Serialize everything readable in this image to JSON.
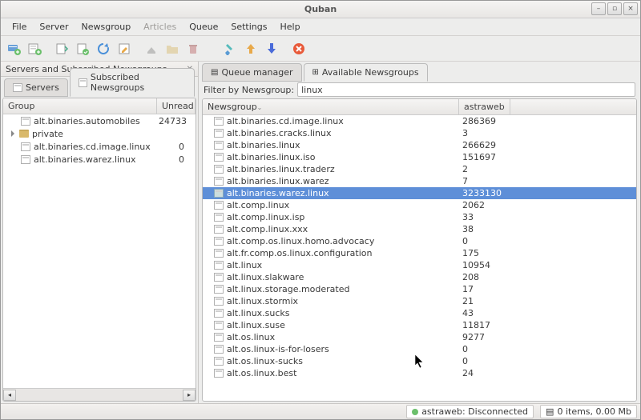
{
  "window": {
    "title": "Quban"
  },
  "menu": [
    "File",
    "Server",
    "Newsgroup",
    "Articles",
    "Queue",
    "Settings",
    "Help"
  ],
  "menu_disabled": [
    3
  ],
  "left": {
    "section_title": "Servers and Subscribed Newsgroups",
    "tabs": [
      {
        "label": "Servers",
        "icon": "server-icon"
      },
      {
        "label": "Subscribed Newsgroups",
        "icon": "news-icon"
      }
    ],
    "active_tab": 1,
    "columns": {
      "group": "Group",
      "unread": "Unread"
    },
    "rows": [
      {
        "name": "alt.binaries.automobiles",
        "unread": "24733",
        "indent": 1,
        "icon": "news"
      },
      {
        "name": "private",
        "unread": "",
        "indent": 0,
        "icon": "folder",
        "collapsible": true
      },
      {
        "name": "alt.binaries.cd.image.linux",
        "unread": "0",
        "indent": 1,
        "icon": "news"
      },
      {
        "name": "alt.binaries.warez.linux",
        "unread": "0",
        "indent": 1,
        "icon": "news"
      }
    ]
  },
  "right": {
    "tabs": [
      {
        "label": "Queue manager",
        "icon": "queue-icon"
      },
      {
        "label": "Available Newsgroups",
        "icon": "groups-icon"
      }
    ],
    "active_tab": 1,
    "filter_label": "Filter by Newsgroup:",
    "filter_value": "linux",
    "columns": {
      "newsgroup": "Newsgroup",
      "count": "astraweb"
    },
    "selected": 6,
    "rows": [
      {
        "name": "alt.binaries.cd.image.linux",
        "count": "286369"
      },
      {
        "name": "alt.binaries.cracks.linux",
        "count": "3"
      },
      {
        "name": "alt.binaries.linux",
        "count": "266629"
      },
      {
        "name": "alt.binaries.linux.iso",
        "count": "151697"
      },
      {
        "name": "alt.binaries.linux.traderz",
        "count": "2"
      },
      {
        "name": "alt.binaries.linux.warez",
        "count": "7"
      },
      {
        "name": "alt.binaries.warez.linux",
        "count": "3233130"
      },
      {
        "name": "alt.comp.linux",
        "count": "2062"
      },
      {
        "name": "alt.comp.linux.isp",
        "count": "33"
      },
      {
        "name": "alt.comp.linux.xxx",
        "count": "38"
      },
      {
        "name": "alt.comp.os.linux.homo.advocacy",
        "count": "0"
      },
      {
        "name": "alt.fr.comp.os.linux.configuration",
        "count": "175"
      },
      {
        "name": "alt.linux",
        "count": "10954"
      },
      {
        "name": "alt.linux.slakware",
        "count": "208"
      },
      {
        "name": "alt.linux.storage.moderated",
        "count": "17"
      },
      {
        "name": "alt.linux.stormix",
        "count": "21"
      },
      {
        "name": "alt.linux.sucks",
        "count": "43"
      },
      {
        "name": "alt.linux.suse",
        "count": "11817"
      },
      {
        "name": "alt.os.linux",
        "count": "9277"
      },
      {
        "name": "alt.os.linux-is-for-losers",
        "count": "0"
      },
      {
        "name": "alt.os.linux-sucks",
        "count": "0"
      },
      {
        "name": "alt.os.linux.best",
        "count": "24"
      }
    ]
  },
  "status": {
    "server": "astraweb: Disconnected",
    "queue": "0 items, 0.00 Mb"
  },
  "colors": {
    "sel": "#5e8fd8"
  }
}
